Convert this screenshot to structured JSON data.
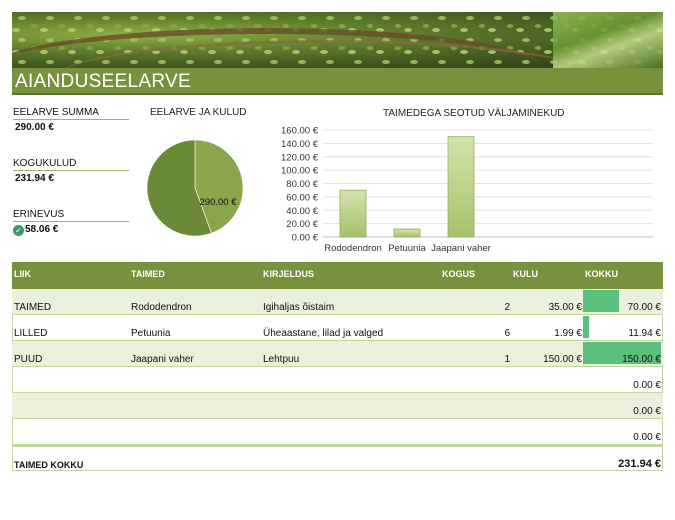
{
  "title": "AIANDUSEELARVE",
  "summary": {
    "budget_label": "EELARVE SUMMA",
    "budget_value": "290.00 €",
    "total_label": "KOGUKULUD",
    "total_value": "231.94 €",
    "diff_label": "ERINEVUS",
    "diff_value": "58.06 €",
    "diff_icon": "check-circle-icon"
  },
  "pie": {
    "title": "EELARVE JA KULUD"
  },
  "bars": {
    "title": "TAIMEDEGA SEOTUD VÄLJAMINEKUD"
  },
  "chart_data": [
    {
      "type": "pie",
      "title": "EELARVE JA KULUD",
      "slices": [
        {
          "label": "231.94 €",
          "value": 231.94,
          "color": "#8aa64a"
        },
        {
          "label": "290.00 €",
          "value": 290.0,
          "color": "#6b8a35"
        }
      ]
    },
    {
      "type": "bar",
      "title": "TAIMEDEGA SEOTUD VÄLJAMINEKUD",
      "categories": [
        "Rododendron",
        "Petuunia",
        "Jaapani vaher"
      ],
      "values": [
        70.0,
        11.94,
        150.0
      ],
      "ylim": [
        0,
        160
      ],
      "yticks": [
        "0.00 €",
        "20.00 €",
        "40.00 €",
        "60.00 €",
        "80.00 €",
        "100.00 €",
        "120.00 €",
        "140.00 €",
        "160.00 €"
      ],
      "grid": true,
      "bar_color": "#b9d08a"
    }
  ],
  "table": {
    "headers": [
      "LIIK",
      "TAIMED",
      "KIRJELDUS",
      "KOGUS",
      "KULU",
      "KOKKU"
    ],
    "rows": [
      {
        "type": "TAIMED",
        "plant": "Rododendron",
        "desc": "Igihaljas õistaim",
        "qty": "2",
        "cost": "35.00 €",
        "total": "70.00 €",
        "amount": 70.0
      },
      {
        "type": "LILLED",
        "plant": "Petuunia",
        "desc": "Üheaastane, lilad ja valged",
        "qty": "6",
        "cost": "1.99 €",
        "total": "11.94 €",
        "amount": 11.94
      },
      {
        "type": "PUUD",
        "plant": "Jaapani vaher",
        "desc": "Lehtpuu",
        "qty": "1",
        "cost": "150.00 €",
        "total": "150.00 €",
        "amount": 150.0
      },
      {
        "type": "",
        "plant": "",
        "desc": "",
        "qty": "",
        "cost": "",
        "total": "0.00 €",
        "amount": 0
      },
      {
        "type": "",
        "plant": "",
        "desc": "",
        "qty": "",
        "cost": "",
        "total": "0.00 €",
        "amount": 0
      },
      {
        "type": "",
        "plant": "",
        "desc": "",
        "qty": "",
        "cost": "",
        "total": "0.00 €",
        "amount": 0
      }
    ],
    "footer_label": "TAIMED KOKKU",
    "footer_total": "231.94 €"
  }
}
